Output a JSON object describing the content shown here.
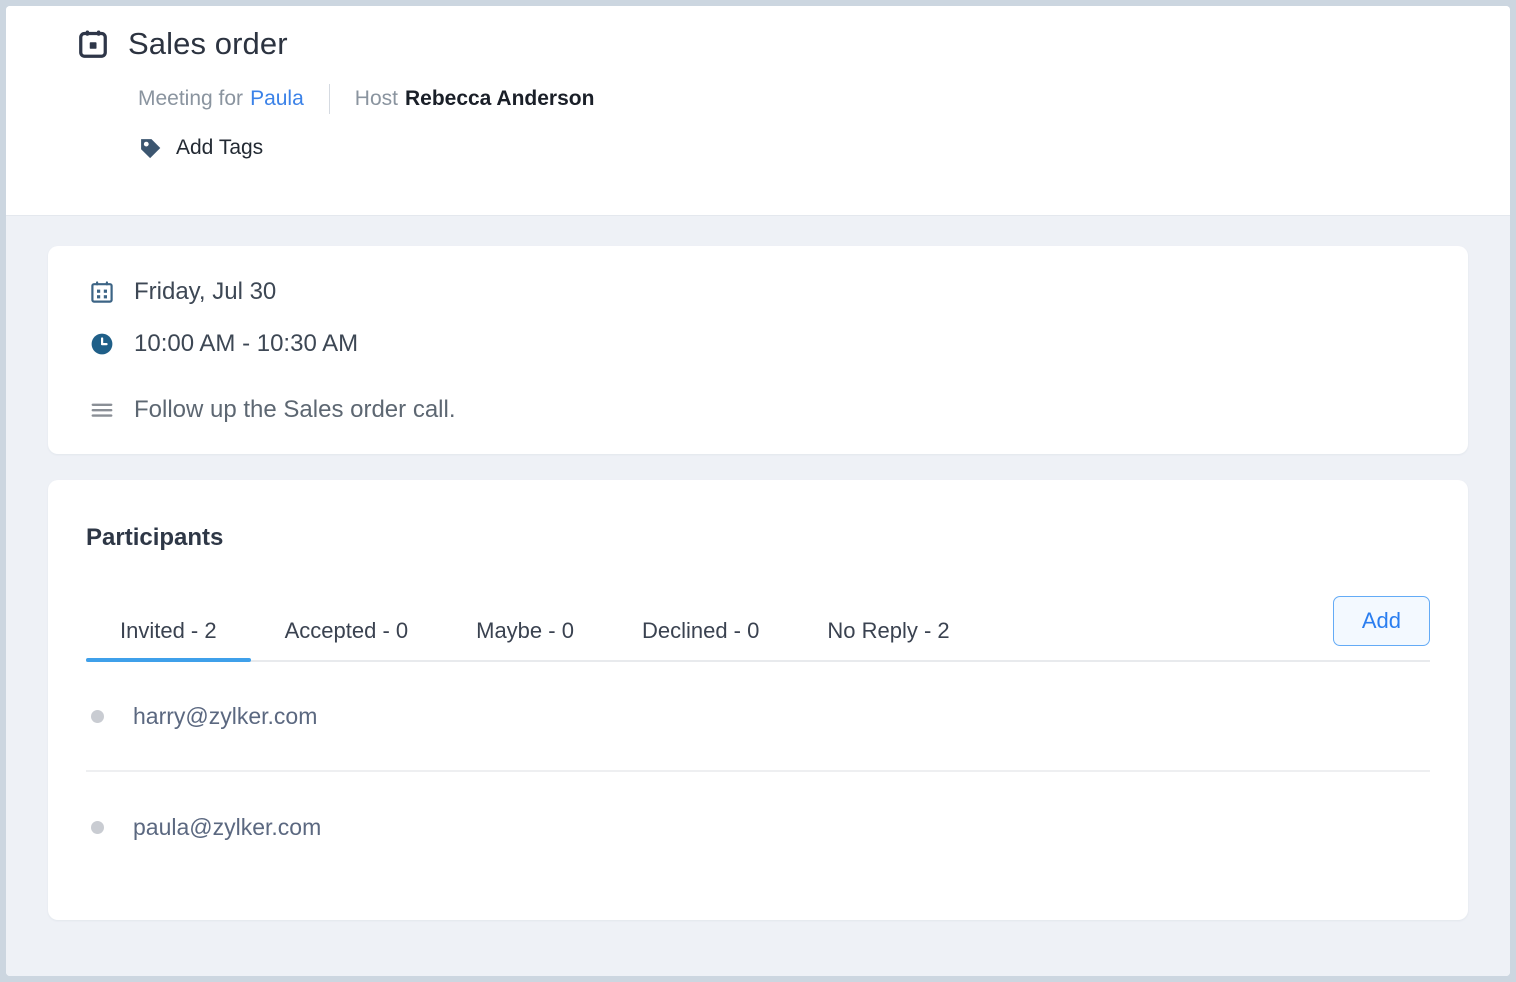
{
  "header": {
    "title": "Sales order",
    "title_icon": "calendar-event-icon",
    "meeting_for_label": "Meeting for",
    "meeting_for_value": "Paula",
    "host_label": "Host",
    "host_value": "Rebecca Anderson",
    "tags_icon": "tag-icon",
    "tags_label": "Add Tags"
  },
  "details": {
    "date_icon": "calendar-icon",
    "date": "Friday, Jul 30",
    "time_icon": "clock-icon",
    "time": "10:00 AM - 10:30 AM",
    "description_icon": "description-lines-icon",
    "description": "Follow up the Sales order call."
  },
  "participants": {
    "section_title": "Participants",
    "tabs": [
      {
        "label": "Invited - 2",
        "active": true
      },
      {
        "label": "Accepted - 0",
        "active": false
      },
      {
        "label": "Maybe - 0",
        "active": false
      },
      {
        "label": "Declined - 0",
        "active": false
      },
      {
        "label": "No Reply - 2",
        "active": false
      }
    ],
    "add_button_label": "Add",
    "list": [
      {
        "email": "harry@zylker.com",
        "status_color": "#c9ccd2"
      },
      {
        "email": "paula@zylker.com",
        "status_color": "#c9ccd2"
      }
    ]
  },
  "colors": {
    "accent_blue": "#3fa0ea",
    "link_blue": "#3b82e8",
    "button_blue": "#2a7ef0",
    "title_dark": "#2c3340",
    "icon_dark_navy": "#2e3648",
    "icon_slate": "#3c6485",
    "body_bg": "#eef1f6",
    "outer_bg": "#ccd6e0"
  }
}
